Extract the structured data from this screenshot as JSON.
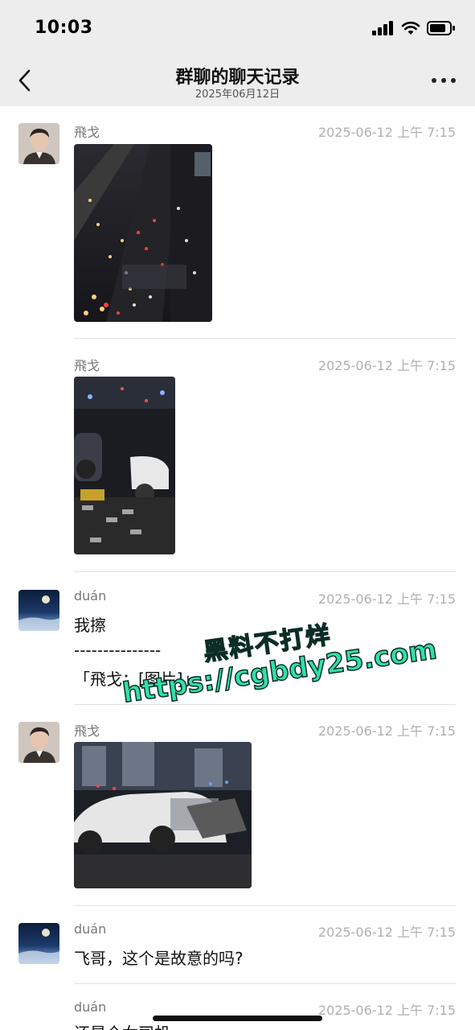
{
  "status_bar": {
    "time": "10:03"
  },
  "header": {
    "title": "群聊的聊天记录",
    "subtitle": "2025年06月12日"
  },
  "messages": [
    {
      "sender": "飛戈",
      "time": "2025-06-12 上午 7:15"
    },
    {
      "sender": "飛戈",
      "time": "2025-06-12 上午 7:15"
    },
    {
      "sender": "duán",
      "time": "2025-06-12 上午 7:15",
      "text": "我擦",
      "separator": "---------------",
      "quote": "「飛戈：[图片]」"
    },
    {
      "sender": "飛戈",
      "time": "2025-06-12 上午 7:15"
    },
    {
      "sender": "duán",
      "time": "2025-06-12 上午 7:15",
      "text": "飞哥，这个是故意的吗?"
    },
    {
      "sender": "duán",
      "time": "2025-06-12 上午 7:15",
      "text": "还是个女司机"
    }
  ],
  "watermark": {
    "line1": "黑料不打烊",
    "line2": "https://cgbdy25.com"
  },
  "colors": {
    "header_bg": "#ededed",
    "watermark": "#30e0a8"
  }
}
